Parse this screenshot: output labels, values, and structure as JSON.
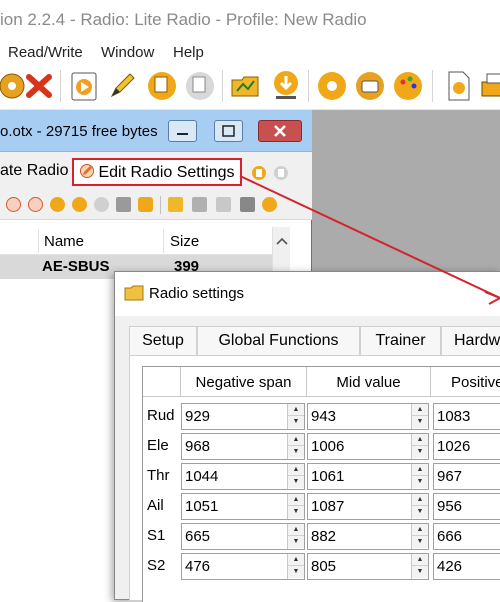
{
  "app": {
    "title": "ion 2.2.4 - Radio: Lite Radio - Profile: New Radio",
    "menu": [
      "Read/Write",
      "Window",
      "Help"
    ]
  },
  "child_window": {
    "title": "o.otx - 29715 free bytes",
    "toolbar": {
      "calibrate_label": "ate Radio",
      "edit_label": "Edit Radio Settings"
    },
    "list": {
      "columns": [
        "Name",
        "Size"
      ],
      "rows": [
        {
          "name": "AE-SBUS",
          "size": "399"
        }
      ]
    }
  },
  "dialog": {
    "title": "Radio settings",
    "tabs": [
      "Setup",
      "Global Functions",
      "Trainer",
      "Hardwar"
    ],
    "columns": [
      "Negative span",
      "Mid value",
      "Positive"
    ],
    "rows": [
      {
        "label": "Rud",
        "neg": "929",
        "mid": "943",
        "pos": "1083"
      },
      {
        "label": "Ele",
        "neg": "968",
        "mid": "1006",
        "pos": "1026"
      },
      {
        "label": "Thr",
        "neg": "1044",
        "mid": "1061",
        "pos": "967"
      },
      {
        "label": "Ail",
        "neg": "1051",
        "mid": "1087",
        "pos": "956"
      },
      {
        "label": "S1",
        "neg": "665",
        "mid": "882",
        "pos": "666"
      },
      {
        "label": "S2",
        "neg": "476",
        "mid": "805",
        "pos": "426"
      }
    ]
  },
  "colors": {
    "highlight": "#d4232f",
    "title_active": "#a8cdf2",
    "mdi_background": "#ababab"
  },
  "icons": {
    "toolbar": [
      "disc-icon",
      "delete-icon",
      "play-icon",
      "pencil-icon",
      "copy-icon",
      "paste-icon",
      "open-folder-icon",
      "download-icon",
      "settings-gear-icon",
      "radio-profile-icon",
      "palette-icon",
      "document-icon",
      "printer-icon"
    ]
  }
}
